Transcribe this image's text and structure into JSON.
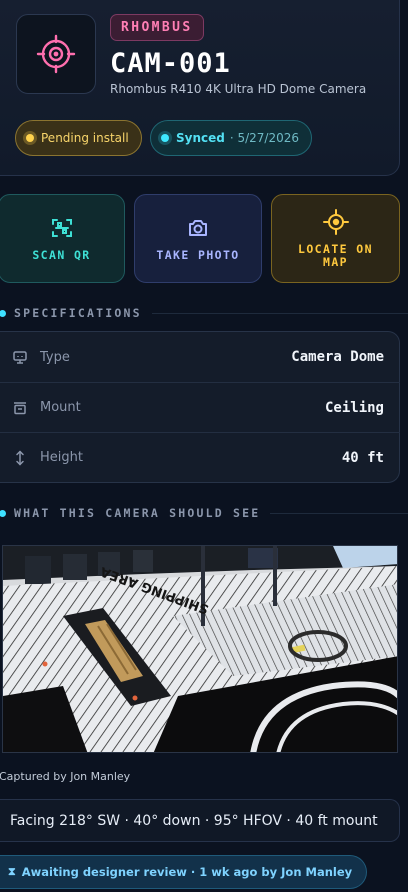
{
  "header": {
    "brand": "RHOMBUS",
    "camera_id": "CAM-001",
    "model": "Rhombus R410 4K Ultra HD Dome Camera",
    "status_pending": "Pending install",
    "status_synced": "Synced",
    "synced_date": "· 5/27/2026"
  },
  "actions": {
    "scan": "SCAN QR",
    "photo": "TAKE PHOTO",
    "locate_line1": "LOCATE ON",
    "locate_line2": "MAP"
  },
  "specs": {
    "title": "SPECIFICATIONS",
    "rows": [
      {
        "key": "Type",
        "value": "Camera Dome",
        "icon": "camera-type-icon"
      },
      {
        "key": "Mount",
        "value": "Ceiling",
        "icon": "mount-icon"
      },
      {
        "key": "Height",
        "value": "40 ft",
        "icon": "height-icon"
      }
    ]
  },
  "view": {
    "title": "WHAT THIS CAMERA SHOULD SEE",
    "scene_floor_text": "SHIPPING AREA",
    "caption": "Captured by Jon Manley",
    "facing": "Facing 218° SW · 40° down · 95° HFOV · 40 ft mount"
  },
  "review": {
    "text": "Awaiting designer review · 1 wk ago by Jon Manley",
    "icon": "hourglass-icon"
  },
  "colors": {
    "background": "#0b1220",
    "brand_pink": "#ff7fb5",
    "pending_amber": "#f8d56b",
    "synced_cyan": "#53e0f3",
    "scan_teal": "#3ee0d5",
    "photo_indigo": "#a9b5ff",
    "locate_gold": "#ffc93e"
  }
}
